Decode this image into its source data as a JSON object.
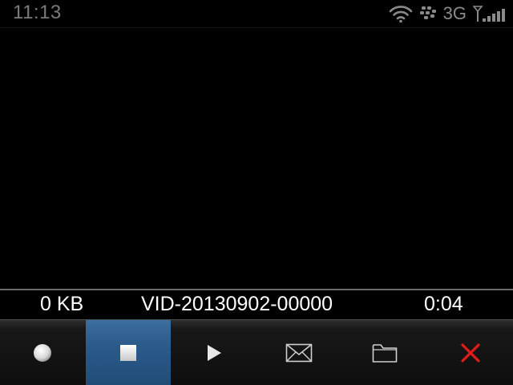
{
  "status_bar": {
    "time": "11:13",
    "network": "3G",
    "icons": [
      "wifi-icon",
      "blackberry-logo-icon",
      "signal-strength-icon"
    ]
  },
  "info_bar": {
    "size": "0 KB",
    "filename": "VID-20130902-00000",
    "duration": "0:04"
  },
  "toolbar": {
    "selected": "stop",
    "buttons": [
      {
        "id": "record",
        "icon": "record-icon"
      },
      {
        "id": "stop",
        "icon": "stop-icon"
      },
      {
        "id": "play",
        "icon": "play-icon"
      },
      {
        "id": "send",
        "icon": "envelope-icon"
      },
      {
        "id": "browse",
        "icon": "folder-icon"
      },
      {
        "id": "close",
        "icon": "close-icon"
      }
    ]
  },
  "colors": {
    "selected_tool": "#2b5a8a",
    "close_icon": "#e01b1b",
    "status_text": "#7a7a7a"
  }
}
